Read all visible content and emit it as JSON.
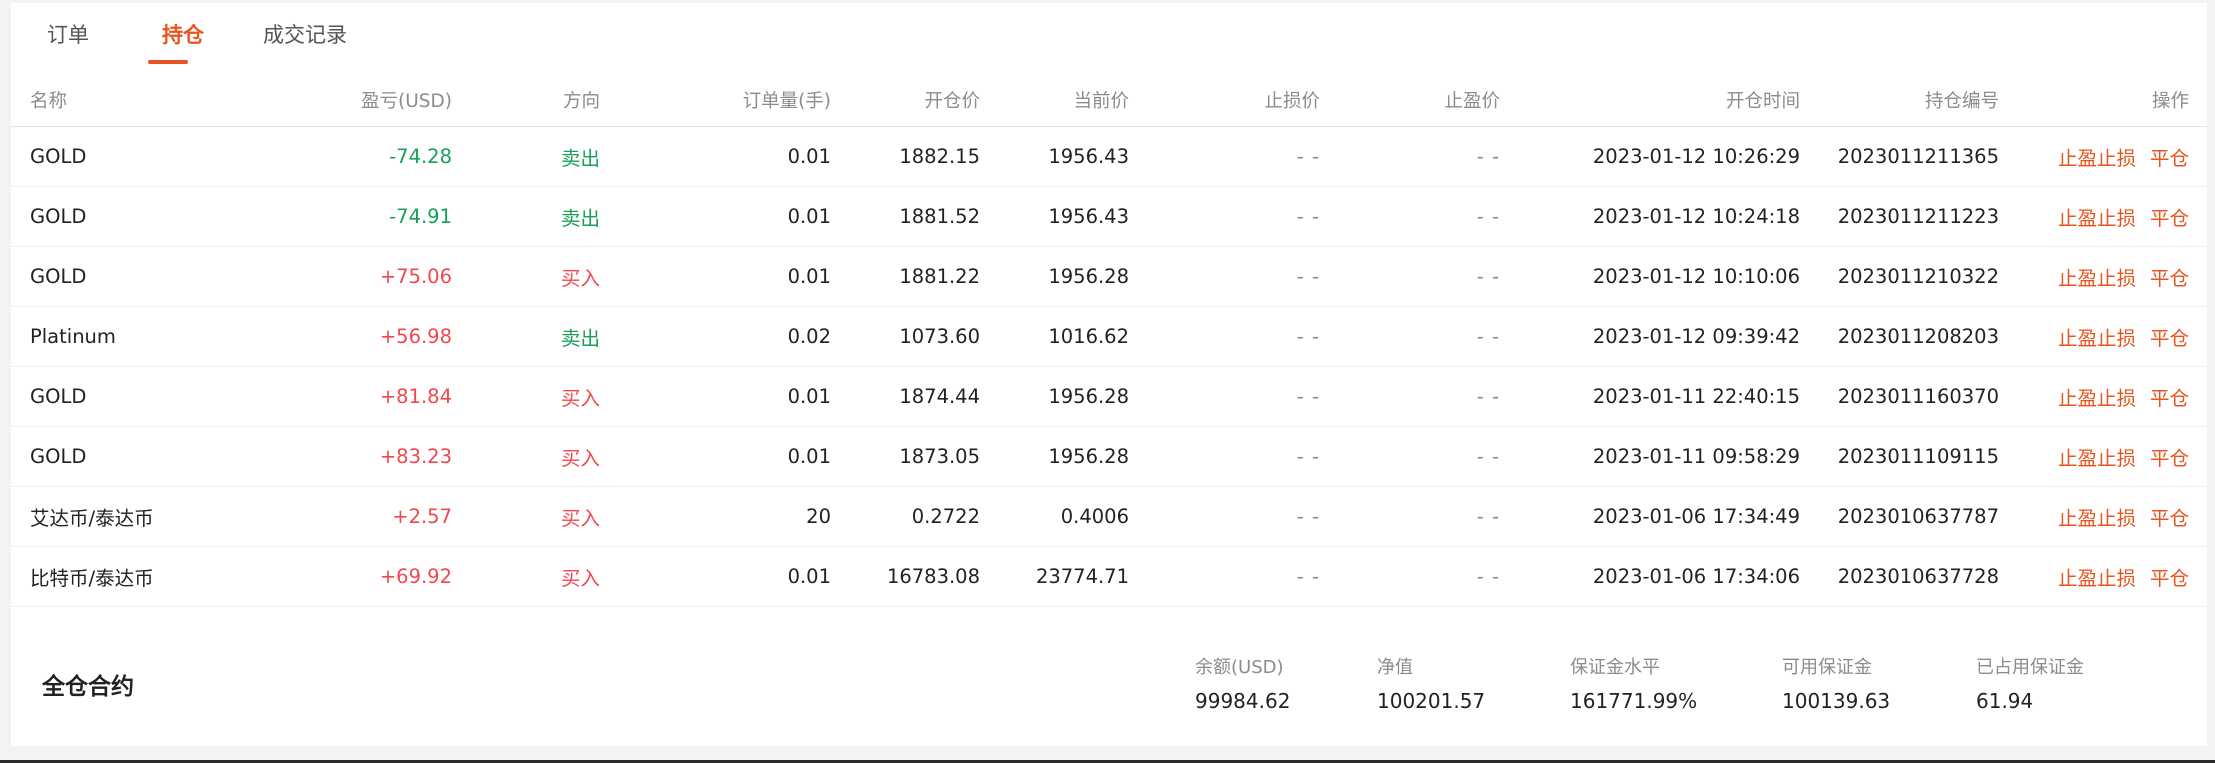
{
  "tabs": [
    {
      "label": "订单",
      "active": false
    },
    {
      "label": "持仓",
      "active": true
    },
    {
      "label": "成交记录",
      "active": false
    }
  ],
  "table": {
    "headers": {
      "name": "名称",
      "pnl": "盈亏(USD)",
      "direction": "方向",
      "quantity": "订单量(手)",
      "open_price": "开仓价",
      "current_price": "当前价",
      "stop_loss": "止损价",
      "take_profit": "止盈价",
      "open_time": "开仓时间",
      "position_id": "持仓编号",
      "actions": "操作"
    },
    "rows": [
      {
        "name": "GOLD",
        "pnl": "-74.28",
        "direction": "卖出",
        "quantity": "0.01",
        "open_price": "1882.15",
        "current_price": "1956.43",
        "stop_loss": "- -",
        "take_profit": "- -",
        "open_time": "2023-01-12 10:26:29",
        "position_id": "2023011211365",
        "action_tpsl": "止盈止损",
        "action_close": "平仓"
      },
      {
        "name": "GOLD",
        "pnl": "-74.91",
        "direction": "卖出",
        "quantity": "0.01",
        "open_price": "1881.52",
        "current_price": "1956.43",
        "stop_loss": "- -",
        "take_profit": "- -",
        "open_time": "2023-01-12 10:24:18",
        "position_id": "2023011211223",
        "action_tpsl": "止盈止损",
        "action_close": "平仓"
      },
      {
        "name": "GOLD",
        "pnl": "+75.06",
        "direction": "买入",
        "quantity": "0.01",
        "open_price": "1881.22",
        "current_price": "1956.28",
        "stop_loss": "- -",
        "take_profit": "- -",
        "open_time": "2023-01-12 10:10:06",
        "position_id": "2023011210322",
        "action_tpsl": "止盈止损",
        "action_close": "平仓"
      },
      {
        "name": "Platinum",
        "pnl": "+56.98",
        "direction": "卖出",
        "quantity": "0.02",
        "open_price": "1073.60",
        "current_price": "1016.62",
        "stop_loss": "- -",
        "take_profit": "- -",
        "open_time": "2023-01-12 09:39:42",
        "position_id": "2023011208203",
        "action_tpsl": "止盈止损",
        "action_close": "平仓"
      },
      {
        "name": "GOLD",
        "pnl": "+81.84",
        "direction": "买入",
        "quantity": "0.01",
        "open_price": "1874.44",
        "current_price": "1956.28",
        "stop_loss": "- -",
        "take_profit": "- -",
        "open_time": "2023-01-11 22:40:15",
        "position_id": "2023011160370",
        "action_tpsl": "止盈止损",
        "action_close": "平仓"
      },
      {
        "name": "GOLD",
        "pnl": "+83.23",
        "direction": "买入",
        "quantity": "0.01",
        "open_price": "1873.05",
        "current_price": "1956.28",
        "stop_loss": "- -",
        "take_profit": "- -",
        "open_time": "2023-01-11 09:58:29",
        "position_id": "2023011109115",
        "action_tpsl": "止盈止损",
        "action_close": "平仓"
      },
      {
        "name": "艾达币/泰达币",
        "pnl": "+2.57",
        "direction": "买入",
        "quantity": "20",
        "open_price": "0.2722",
        "current_price": "0.4006",
        "stop_loss": "- -",
        "take_profit": "- -",
        "open_time": "2023-01-06 17:34:49",
        "position_id": "2023010637787",
        "action_tpsl": "止盈止损",
        "action_close": "平仓"
      },
      {
        "name": "比特币/泰达币",
        "pnl": "+69.92",
        "direction": "买入",
        "quantity": "0.01",
        "open_price": "16783.08",
        "current_price": "23774.71",
        "stop_loss": "- -",
        "take_profit": "- -",
        "open_time": "2023-01-06 17:34:06",
        "position_id": "2023010637728",
        "action_tpsl": "止盈止损",
        "action_close": "平仓"
      }
    ]
  },
  "summary": {
    "title": "全仓合约",
    "metrics": [
      {
        "label": "余额(USD)",
        "value": "99984.62"
      },
      {
        "label": "净值",
        "value": "100201.57"
      },
      {
        "label": "保证金水平",
        "value": "161771.99%"
      },
      {
        "label": "可用保证金",
        "value": "100139.63"
      },
      {
        "label": "已占用保证金",
        "value": "61.94"
      }
    ]
  },
  "colors": {
    "accent": "#e8541e",
    "profit": "#f0484e",
    "loss": "#18a058"
  }
}
